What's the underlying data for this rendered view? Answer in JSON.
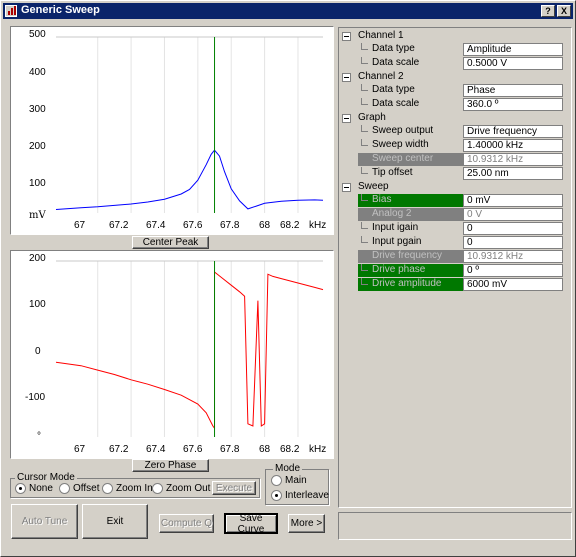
{
  "window": {
    "title": "Generic Sweep",
    "help_label": "?",
    "close_label": "X"
  },
  "graph1": {
    "y_ticks": [
      "500",
      "400",
      "300",
      "200",
      "100",
      "mV"
    ],
    "x_ticks": [
      "67",
      "67.2",
      "67.4",
      "67.6",
      "67.8",
      "68",
      "68.2",
      "kHz"
    ],
    "button": "Center Peak",
    "colors": {
      "curve": "#0000ff",
      "cursor": "#008000"
    }
  },
  "graph2": {
    "y_ticks": [
      "200",
      "100",
      "0",
      "-100",
      "°"
    ],
    "x_ticks": [
      "67",
      "67.2",
      "67.4",
      "67.6",
      "67.8",
      "68",
      "68.2",
      "kHz"
    ],
    "button": "Zero Phase",
    "colors": {
      "curve": "#ff0000",
      "cursor": "#008000"
    }
  },
  "chart_data": [
    {
      "type": "line",
      "series": [
        {
          "x": [
            66.75,
            66.9,
            67.0,
            67.1,
            67.2,
            67.3,
            67.4,
            67.5,
            67.55,
            67.6,
            67.65,
            67.68,
            67.7,
            67.73,
            67.76,
            67.8,
            67.85,
            67.9,
            67.95,
            68.0,
            68.1,
            68.2,
            68.3,
            68.35
          ],
          "values": [
            0,
            5,
            8,
            12,
            16,
            22,
            30,
            45,
            58,
            85,
            130,
            160,
            172,
            155,
            110,
            60,
            25,
            2,
            10,
            18,
            24,
            27,
            28,
            27
          ]
        }
      ],
      "xlabel": "kHz",
      "ylabel": "mV",
      "xlim": [
        66.75,
        68.35
      ],
      "ylim": [
        -10,
        500
      ],
      "grid": true
    },
    {
      "type": "line",
      "series": [
        {
          "x": [
            66.75,
            66.9,
            67.0,
            67.1,
            67.2,
            67.3,
            67.4,
            67.5,
            67.6,
            67.65,
            67.69,
            67.7,
            67.7,
            67.75,
            67.8,
            67.85,
            67.88,
            67.9,
            67.93,
            67.96,
            67.98,
            68.0,
            68.02,
            68.05,
            68.1,
            68.2,
            68.3,
            68.35
          ],
          "values": [
            -30,
            -38,
            -48,
            -58,
            -70,
            -80,
            -92,
            -105,
            -125,
            -145,
            -175,
            -180,
            175,
            160,
            145,
            130,
            120,
            -170,
            -175,
            110,
            -175,
            -170,
            170,
            165,
            160,
            150,
            140,
            135
          ]
        }
      ],
      "xlabel": "kHz",
      "ylabel": "°",
      "xlim": [
        66.75,
        68.35
      ],
      "ylim": [
        -200,
        200
      ],
      "grid": true
    }
  ],
  "cursor_mode": {
    "label": "Cursor Mode",
    "options": [
      "None",
      "Offset",
      "Zoom In",
      "Zoom Out"
    ],
    "selected": "None",
    "execute": "Execute"
  },
  "mode": {
    "label": "Mode",
    "options": [
      "Main",
      "Interleave"
    ],
    "selected": "Interleave"
  },
  "buttons": {
    "auto_tune": "Auto Tune",
    "exit": "Exit",
    "compute_q": "Compute Q",
    "save_curve": "Save Curve",
    "more": "More >"
  },
  "tree": {
    "channel1": {
      "label": "Channel 1",
      "data_type_label": "Data type",
      "data_type": "Amplitude",
      "data_scale_label": "Data scale",
      "data_scale": "0.5000 V"
    },
    "channel2": {
      "label": "Channel 2",
      "data_type_label": "Data type",
      "data_type": "Phase",
      "data_scale_label": "Data scale",
      "data_scale": "360.0 º"
    },
    "graph": {
      "label": "Graph",
      "sweep_output_label": "Sweep output",
      "sweep_output": "Drive frequency",
      "sweep_width_label": "Sweep width",
      "sweep_width": "1.40000 kHz",
      "sweep_center_label": "Sweep center",
      "sweep_center": "10.9312 kHz",
      "tip_offset_label": "Tip offset",
      "tip_offset": "25.00 nm"
    },
    "sweep": {
      "label": "Sweep",
      "bias_label": "Bias",
      "bias": "0 mV",
      "analog2_label": "Analog 2",
      "analog2": "0 V",
      "input_igain_label": "Input igain",
      "input_igain": "0",
      "input_pgain_label": "Input pgain",
      "input_pgain": "0",
      "drive_frequency_label": "Drive frequency",
      "drive_frequency": "10.9312 kHz",
      "drive_phase_label": "Drive phase",
      "drive_phase": "0 º",
      "drive_amplitude_label": "Drive amplitude",
      "drive_amplitude": "6000 mV"
    }
  }
}
